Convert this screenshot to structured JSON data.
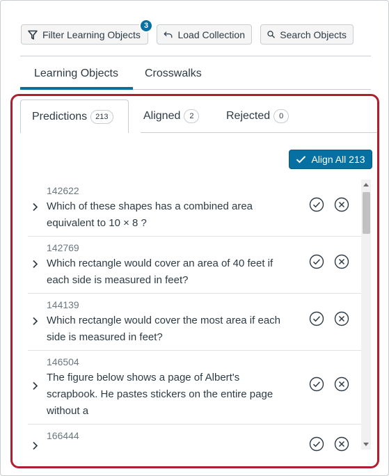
{
  "toolbar": {
    "filter_label": "Filter Learning Objects",
    "filter_badge": "3",
    "load_label": "Load Collection",
    "search_label": "Search Objects"
  },
  "main_tabs": [
    "Learning Objects",
    "Crosswalks"
  ],
  "sub_tabs": [
    {
      "label": "Predictions",
      "count": "213"
    },
    {
      "label": "Aligned",
      "count": "2"
    },
    {
      "label": "Rejected",
      "count": "0"
    }
  ],
  "align_all_label": "Align All 213",
  "items": [
    {
      "id": "142622",
      "lines": [
        "Which of these shapes has a combined area",
        "equivalent to 10 × 8 ?"
      ]
    },
    {
      "id": "142769",
      "lines": [
        "Which rectangle would cover an area of 40 feet if",
        "each side is measured in feet?"
      ]
    },
    {
      "id": "144139",
      "lines": [
        "Which rectangle would cover the most area if each",
        "side is measured in feet?"
      ]
    },
    {
      "id": "146504",
      "lines": [
        "The figure below shows a page of Albert's",
        "scrapbook. He pastes stickers on the entire page",
        "without a"
      ]
    },
    {
      "id": "166444",
      "lines": []
    }
  ],
  "colors": {
    "accent": "#0770a3",
    "highlight": "#b01f2f"
  }
}
